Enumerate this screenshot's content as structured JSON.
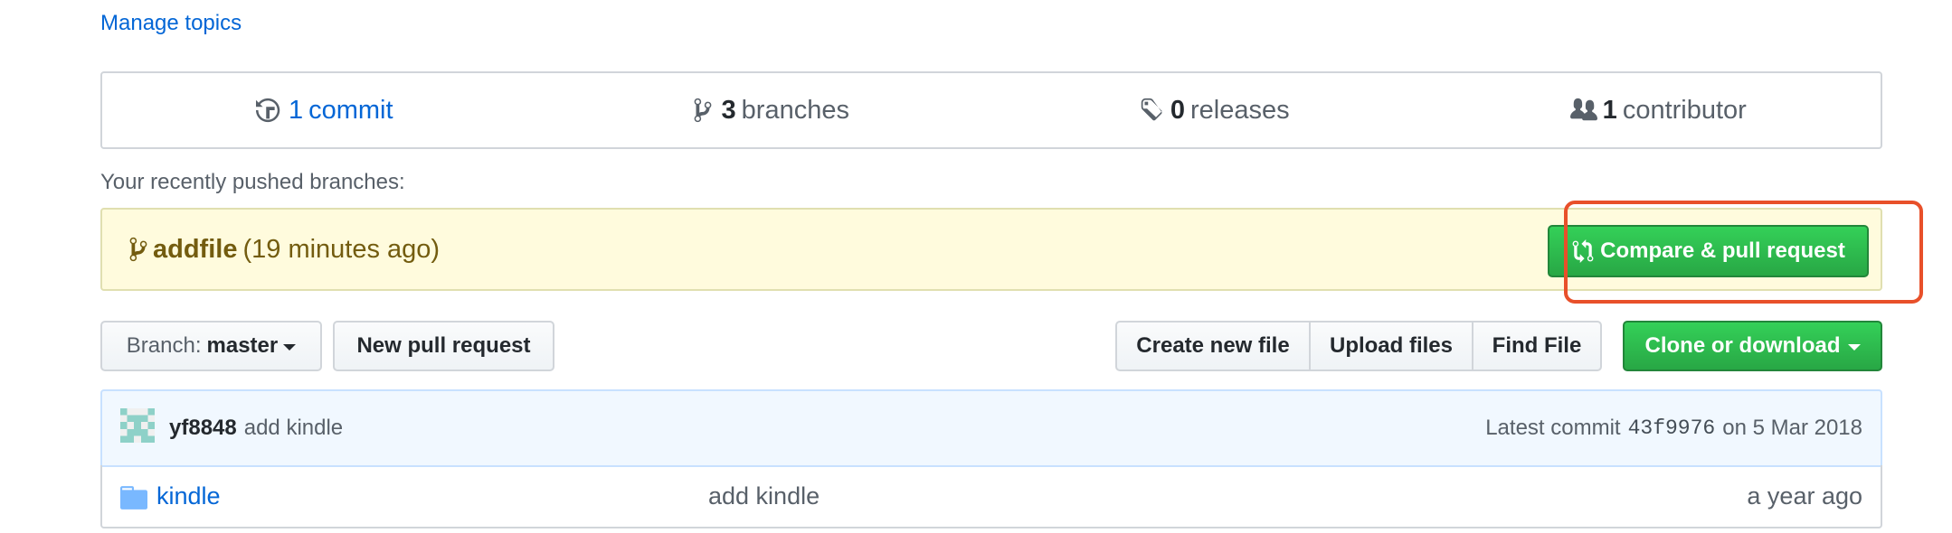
{
  "manage_topics": "Manage topics",
  "stats": {
    "commits": {
      "count": "1",
      "label": "commit"
    },
    "branches": {
      "count": "3",
      "label": "branches"
    },
    "releases": {
      "count": "0",
      "label": "releases"
    },
    "contributors": {
      "count": "1",
      "label": "contributor"
    }
  },
  "recent": {
    "label": "Your recently pushed branches:",
    "branch": "addfile",
    "time": "(19 minutes ago)",
    "compare_button": "Compare & pull request"
  },
  "toolbar": {
    "branch_label": "Branch:",
    "branch_value": "master",
    "new_pr": "New pull request",
    "create_file": "Create new file",
    "upload_files": "Upload files",
    "find_file": "Find File",
    "clone": "Clone or download"
  },
  "commit": {
    "user": "yf8848",
    "message": "add kindle",
    "latest_label": "Latest commit",
    "sha": "43f9976",
    "date": "on 5 Mar 2018"
  },
  "files": [
    {
      "name": "kindle",
      "message": "add kindle",
      "age": "a year ago"
    }
  ],
  "colors": {
    "link": "#0366d6",
    "green": "#28a745",
    "highlight": "#e8502a",
    "banner": "#fffbdd"
  }
}
